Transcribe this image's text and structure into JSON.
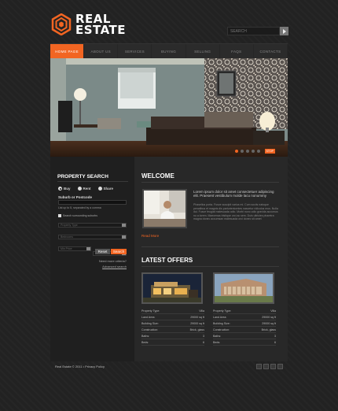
{
  "logo": {
    "line1": "REAL",
    "line2": "ESTATE"
  },
  "search": {
    "placeholder": "SEARCH"
  },
  "nav": [
    "HOME PAGE",
    "ABOUT US",
    "SERVICES",
    "BUYING",
    "SELLING",
    "FAQS",
    "CONTACTS"
  ],
  "hero": {
    "stop_label": "STOP"
  },
  "property_search": {
    "title": "PROPERTY SEARCH",
    "radio_buy": "Buy",
    "radio_rent": "Rent",
    "radio_share": "Share",
    "suburb_label": "Suburb or Postcode",
    "hint": "List up to 5, separated by a comma",
    "checkbox_label": "Search surrounding suburbs",
    "select_type": "Property Type",
    "select_bedrooms": "Bedrooms",
    "select_min": "Min Price",
    "select_max": "Max Price",
    "reset": "Reset",
    "search": "Search",
    "need_more": "Need more criteria?",
    "advanced": "Advanced search"
  },
  "welcome": {
    "title": "WELCOME",
    "lead": "Lorem ipsum dolor sit amet consectetuer adipiscing elit. Praesent vestibulum molde lacu nonummy",
    "body": "Phasellus porta. Fusce suscipit varius mi. Cum sociis natoque penatibus et magnis dis parturientomtes nascetur ridiculus mus. Nulla dui. Fusce feugiat malesuada odio. Morbi nunc odio gravida accumus no a lorem. Maecenas tristique orci ac sem. Duis ultricies pharetra magna donec accumsan malesuada orci donec sit amet",
    "read_more": "Read More"
  },
  "offers": {
    "title": "LATEST OFFERS",
    "items": [
      {
        "rows": [
          [
            "Property Type:",
            "Villa"
          ],
          [
            "Land Area:",
            "29000 sq ft"
          ],
          [
            "Building Size:",
            "29000 sq ft"
          ],
          [
            "Construction:",
            "Brick, glass"
          ],
          [
            "Baths:",
            "3"
          ],
          [
            "Beds:",
            "6"
          ]
        ]
      },
      {
        "rows": [
          [
            "Property Type:",
            "Villa"
          ],
          [
            "Land Area:",
            "29000 sq ft"
          ],
          [
            "Building Size:",
            "29000 sq ft"
          ],
          [
            "Construction:",
            "Brick, glass"
          ],
          [
            "Baths:",
            "3"
          ],
          [
            "Beds:",
            "6"
          ]
        ]
      }
    ]
  },
  "footer": {
    "text": "Real Estate © 2011 • Privacy Policy"
  },
  "colors": {
    "accent": "#f26522",
    "bg": "#222222"
  },
  "social_icons": [
    "rss-icon",
    "facebook-icon",
    "twitter-icon",
    "share-icon"
  ]
}
